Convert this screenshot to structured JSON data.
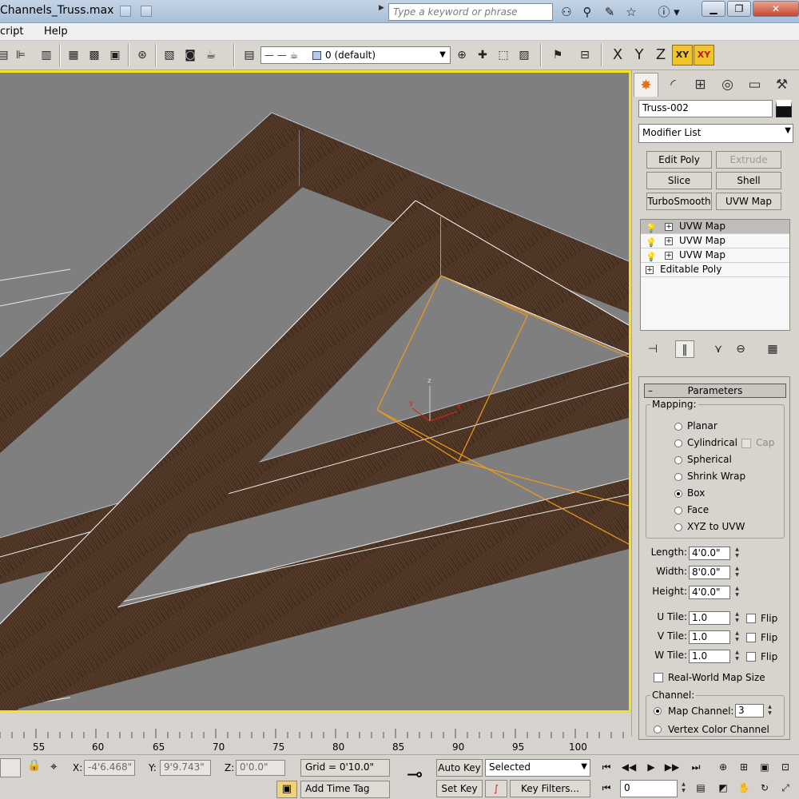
{
  "window": {
    "title": "Channels_Truss.max",
    "search_placeholder": "Type a keyword or phrase"
  },
  "menu": [
    "cript",
    "Help"
  ],
  "toolbar": {
    "layer_label": "0 (default)",
    "axis_buttons": [
      "X",
      "Y",
      "Z",
      "XY",
      "XY"
    ]
  },
  "command_panel": {
    "object_name": "Truss-002",
    "object_color": "#000000",
    "modifier_list_label": "Modifier List",
    "modifier_buttons": [
      {
        "label": "Edit Poly",
        "enabled": true
      },
      {
        "label": "Extrude",
        "enabled": false
      },
      {
        "label": "Slice",
        "enabled": true
      },
      {
        "label": "Shell",
        "enabled": true
      },
      {
        "label": "TurboSmooth",
        "enabled": true
      },
      {
        "label": "UVW Map",
        "enabled": true
      }
    ],
    "stack": [
      {
        "label": "UVW Map",
        "selected": true
      },
      {
        "label": "UVW Map",
        "selected": false
      },
      {
        "label": "UVW Map",
        "selected": false
      },
      {
        "label": "Editable Poly",
        "selected": false
      }
    ],
    "rollout_title": "Parameters",
    "mapping": {
      "group_label": "Mapping:",
      "options": [
        "Planar",
        "Cylindrical",
        "Spherical",
        "Shrink Wrap",
        "Box",
        "Face",
        "XYZ to UVW"
      ],
      "selected": "Box",
      "cap_label": "Cap"
    },
    "dimensions": {
      "length_label": "Length:",
      "length": "4'0.0\"",
      "width_label": "Width:",
      "width": "8'0.0\"",
      "height_label": "Height:",
      "height": "4'0.0\""
    },
    "tiles": {
      "u_label": "U Tile:",
      "u": "1.0",
      "v_label": "V Tile:",
      "v": "1.0",
      "w_label": "W Tile:",
      "w": "1.0",
      "flip_label": "Flip"
    },
    "real_world_label": "Real-World Map Size",
    "channel": {
      "group_label": "Channel:",
      "map_channel_label": "Map Channel:",
      "map_channel": "3",
      "vertex_color_label": "Vertex Color Channel"
    }
  },
  "timeline": {
    "ticks": [
      "55",
      "60",
      "65",
      "70",
      "75",
      "80",
      "85",
      "90",
      "95",
      "100"
    ]
  },
  "status": {
    "x_label": "X:",
    "x": "-4'6.468\"",
    "y_label": "Y:",
    "y": "9'9.743\"",
    "z_label": "Z:",
    "z": "0'0.0\"",
    "grid": "Grid = 0'10.0\"",
    "add_time_tag": "Add Time Tag",
    "auto_key": "Auto Key",
    "set_key": "Set Key",
    "selected_dropdown": "Selected",
    "key_filters": "Key Filters...",
    "frame": "0"
  },
  "viewport_axes": {
    "x": "x",
    "y": "y",
    "z": "z"
  }
}
